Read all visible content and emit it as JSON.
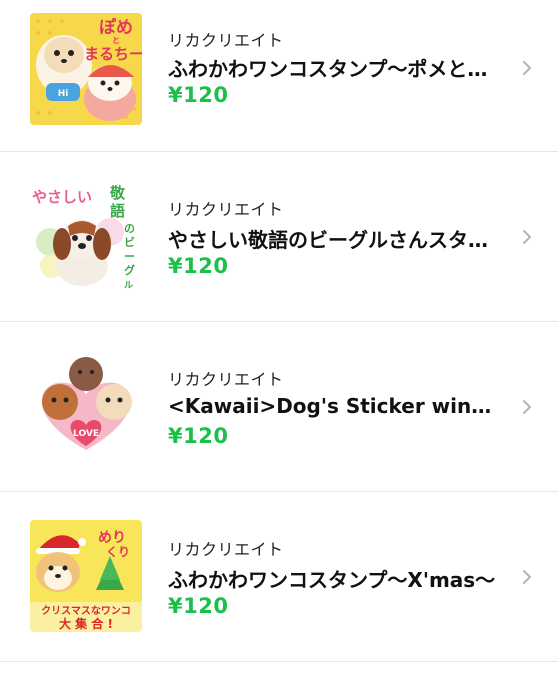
{
  "items": [
    {
      "thumb_text": "ぽめとまるちー",
      "author": "リカクリエイト",
      "title": "ふわかわワンコスタンプ～ポメとまるちー～",
      "price": "¥120",
      "icon": "chevron-right-icon"
    },
    {
      "thumb_text": "やさしい敬語のビーグルさん",
      "author": "リカクリエイト",
      "title": "やさしい敬語のビーグルさんスタンプ",
      "price": "¥120",
      "icon": "chevron-right-icon"
    },
    {
      "thumb_text": "LOVE",
      "author": "リカクリエイト",
      "title": "<Kawaii>Dog's Sticker winter version",
      "price": "¥120",
      "icon": "chevron-right-icon"
    },
    {
      "thumb_text": "めりくり クリスマスなワンコ 大集合!",
      "author": "リカクリエイト",
      "title": "ふわかわワンコスタンプ～X'mas～",
      "price": "¥120",
      "icon": "chevron-right-icon"
    }
  ],
  "colors": {
    "price": "#1bbf4a",
    "divider": "#e6e6e6",
    "chevron": "#b5b5b5"
  }
}
